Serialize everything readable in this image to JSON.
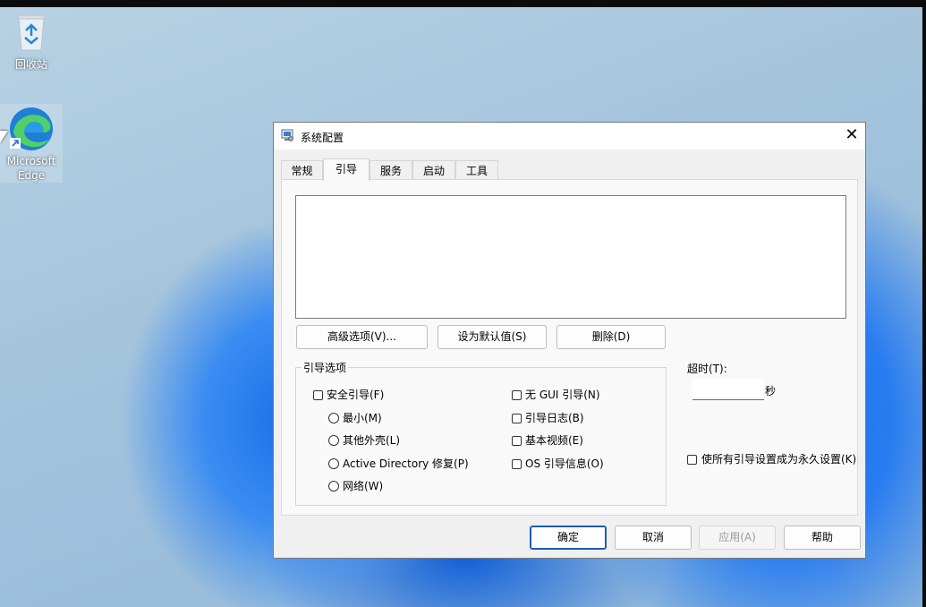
{
  "desktop": {
    "icons": [
      {
        "label": "回收站",
        "icon": "recycle-bin-icon"
      },
      {
        "label_line1": "Microsoft",
        "label_line2": "Edge",
        "icon": "edge-icon"
      }
    ]
  },
  "dialog": {
    "title": "系统配置",
    "close_glyph": "✕",
    "tabs": [
      {
        "label": "常规",
        "active": false
      },
      {
        "label": "引导",
        "active": true
      },
      {
        "label": "服务",
        "active": false
      },
      {
        "label": "启动",
        "active": false
      },
      {
        "label": "工具",
        "active": false
      }
    ],
    "boot_buttons": {
      "advanced": "高级选项(V)...",
      "set_default": "设为默认值(S)",
      "delete": "删除(D)"
    },
    "boot_options": {
      "legend": "引导选项",
      "safe_boot": "安全引导(F)",
      "minimal": "最小(M)",
      "alternate_shell": "其他外壳(L)",
      "ad_repair": "Active Directory 修复(P)",
      "network": "网络(W)",
      "no_gui": "无 GUI 引导(N)",
      "boot_log": "引导日志(B)",
      "base_video": "基本视频(E)",
      "os_boot_info": "OS 引导信息(O)"
    },
    "timeout": {
      "label": "超时(T):",
      "value": "",
      "unit": "秒"
    },
    "permanent_label": "使所有引导设置成为永久设置(K)",
    "footer": {
      "ok": "确定",
      "cancel": "取消",
      "apply": "应用(A)",
      "help": "帮助"
    },
    "colors": {
      "accent": "#1a5fb4",
      "dialog_bg": "#f0f0f0"
    }
  }
}
